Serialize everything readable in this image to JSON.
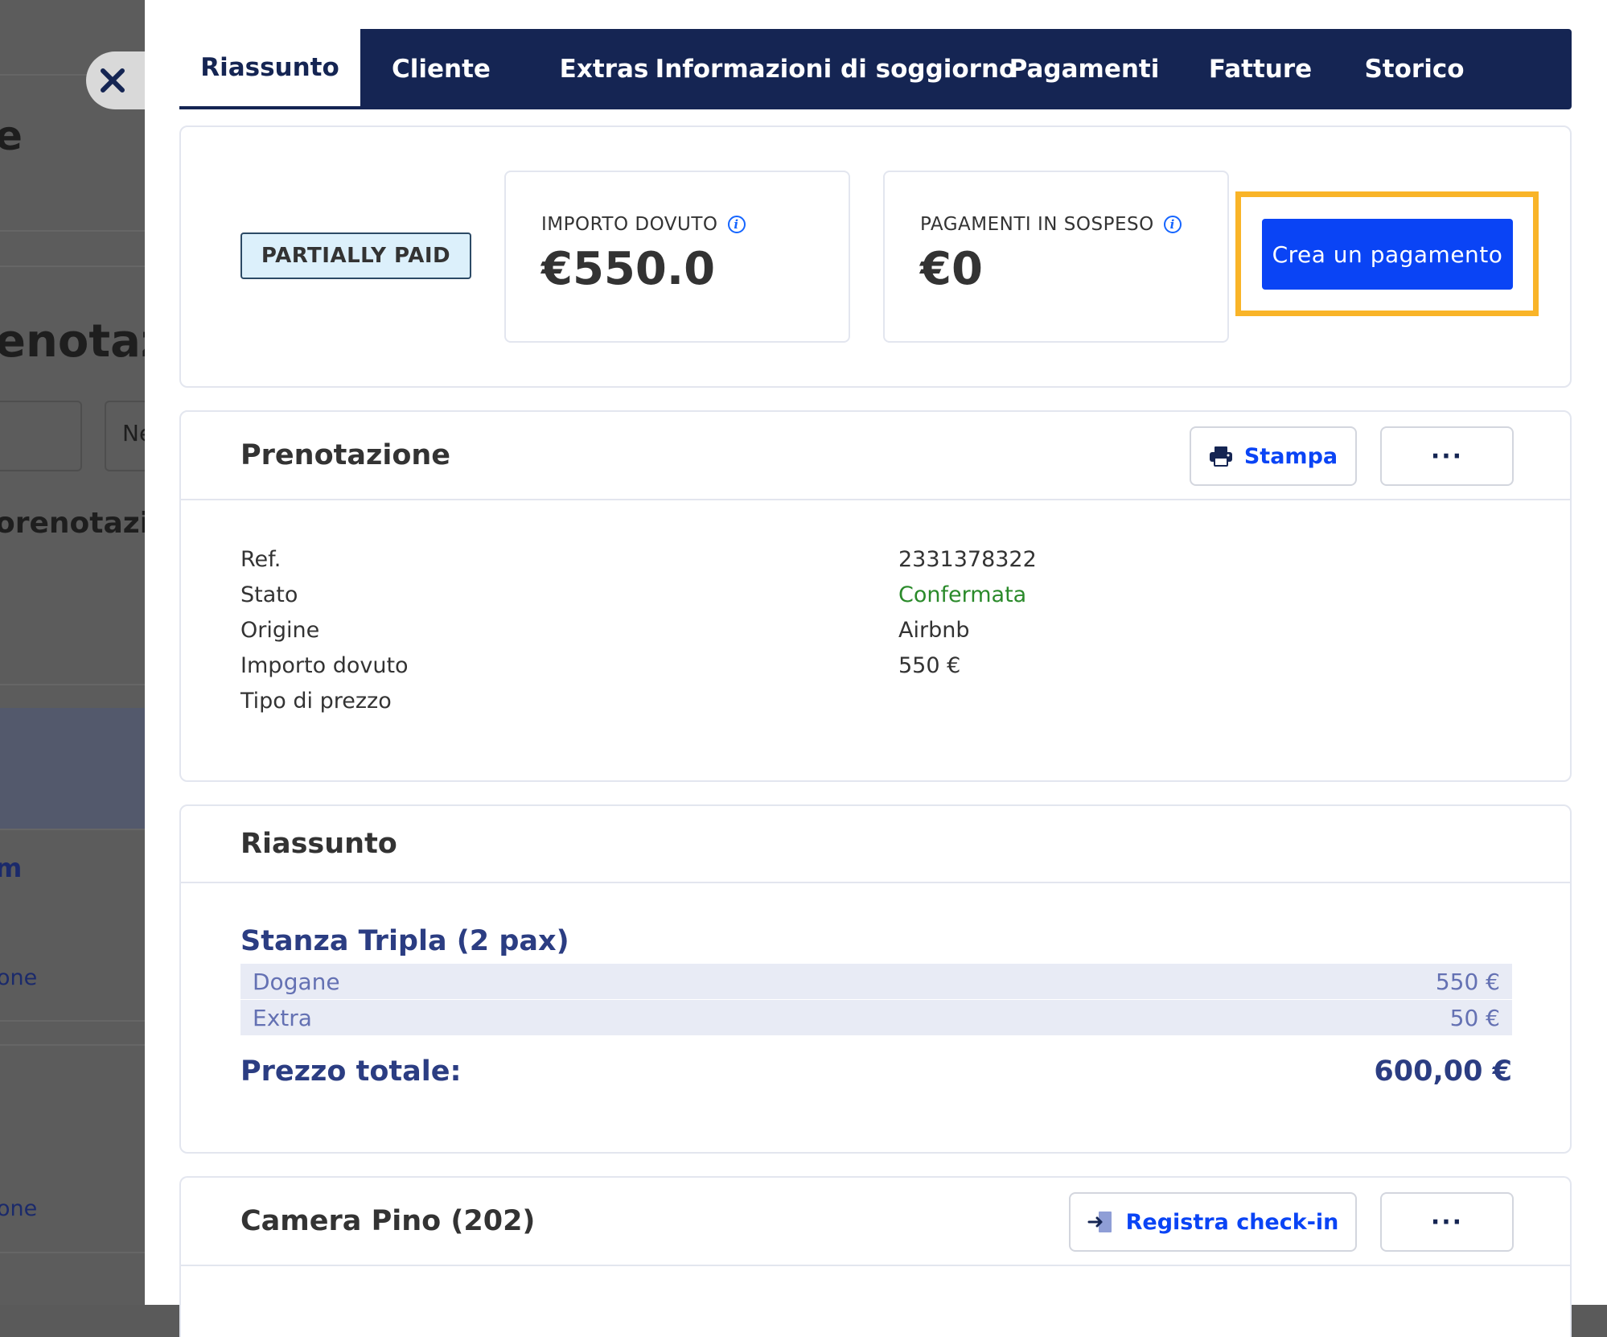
{
  "background": {
    "fragments": [
      "e",
      "enotazi",
      "Ne",
      "orenotazion",
      "m",
      "one",
      "one"
    ]
  },
  "tabs": [
    {
      "label": "Riassunto",
      "active": true
    },
    {
      "label": "Cliente"
    },
    {
      "label": "Extras"
    },
    {
      "label": "Informazioni di soggiorno"
    },
    {
      "label": "Pagamenti"
    },
    {
      "label": "Fatture"
    },
    {
      "label": "Storico"
    }
  ],
  "summary": {
    "status_badge": "PARTIALLY PAID",
    "amount_due_label": "IMPORTO DOVUTO",
    "amount_due_value": "€550.0",
    "pending_label": "PAGAMENTI IN SOSPESO",
    "pending_value": "€0",
    "create_payment_label": "Crea un pagamento"
  },
  "booking": {
    "title": "Prenotazione",
    "print_label": "Stampa",
    "more_label": "···",
    "rows": [
      {
        "label": "Ref.",
        "value": "2331378322"
      },
      {
        "label": "Stato",
        "value": "Confermata"
      },
      {
        "label": "Origine",
        "value": "Airbnb"
      },
      {
        "label": "Importo dovuto",
        "value": "550 €"
      },
      {
        "label": "Tipo di prezzo",
        "value": ""
      }
    ]
  },
  "recap": {
    "title": "Riassunto",
    "room": "Stanza Tripla (2 pax)",
    "lines": [
      {
        "label": "Dogane",
        "value": "550 €"
      },
      {
        "label": "Extra",
        "value": "50 €"
      }
    ],
    "total_label": "Prezzo totale:",
    "total_value": "600,00 €"
  },
  "room_card": {
    "title": "Camera Pino (202)",
    "checkin_label": "Registra check-in",
    "more_label": "···"
  },
  "colors": {
    "navy": "#152553",
    "primary": "#0a44f5",
    "highlight": "#f9b428",
    "confirmed": "#2a8a2a"
  }
}
